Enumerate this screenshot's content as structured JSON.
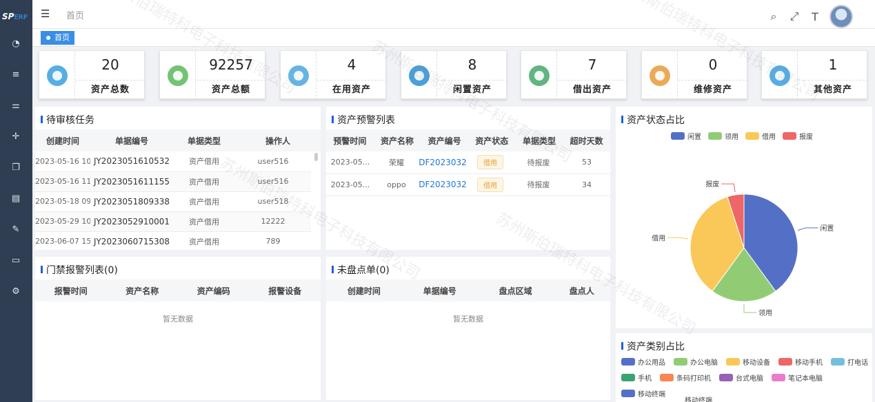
{
  "sidebar": {
    "logo_main": "SP",
    "logo_sub": "ERP",
    "icons": [
      "dashboard-icon",
      "list-icon",
      "sliders-icon",
      "move-icon",
      "box-icon",
      "table-icon",
      "edit-icon",
      "monitor-icon",
      "gear-icon"
    ]
  },
  "topbar": {
    "menu_toggle": "☰",
    "breadcrumb": "首页"
  },
  "tabs": {
    "active": "首页"
  },
  "stats": [
    {
      "value": "20",
      "label": "资产总数",
      "icon": "pie-chart-icon",
      "color": "#3aa0e0"
    },
    {
      "value": "92257",
      "label": "资产总额",
      "icon": "house-icon",
      "color": "#5cb85c"
    },
    {
      "value": "4",
      "label": "在用资产",
      "icon": "gauge-icon",
      "color": "#4aa8df"
    },
    {
      "value": "8",
      "label": "闲置资产",
      "icon": "basket-icon",
      "color": "#2a8fd0"
    },
    {
      "value": "7",
      "label": "借出资产",
      "icon": "tray-icon",
      "color": "#47a86b"
    },
    {
      "value": "0",
      "label": "维修资产",
      "icon": "money-icon",
      "color": "#e69b3c"
    },
    {
      "value": "1",
      "label": "其他资产",
      "icon": "grid-icon",
      "color": "#3aa0e0"
    }
  ],
  "pending": {
    "title": "待审核任务",
    "headers": [
      "创建时间",
      "单据编号",
      "单据类型",
      "操作人"
    ],
    "rows": [
      [
        "2023-05-16 10:...",
        "JY2023051610532",
        "资产借用",
        "user516"
      ],
      [
        "2023-05-16 11:...",
        "JY2023051611155",
        "资产借用",
        "user516"
      ],
      [
        "2023-05-18 09:...",
        "JY2023051809338",
        "资产借用",
        "user518"
      ],
      [
        "2023-05-29 10:...",
        "JY2023052910001",
        "资产借用",
        "12222"
      ],
      [
        "2023-06-07 15:...",
        "JY2023060715308",
        "资产借用",
        "789"
      ]
    ]
  },
  "warning": {
    "title": "资产预警列表",
    "headers": [
      "预警时间",
      "资产名称",
      "资产编号",
      "资产状态",
      "单据类型",
      "超时天数"
    ],
    "rows": [
      [
        "2023-05...",
        "荣耀",
        "DF2023032",
        "借用",
        "待报废",
        "53"
      ],
      [
        "2023-05...",
        "oppo",
        "DF2023032",
        "借用",
        "待报废",
        "34"
      ]
    ]
  },
  "door": {
    "title": "门禁报警列表(0)",
    "headers": [
      "报警时间",
      "资产名称",
      "资产编码",
      "报警设备"
    ],
    "empty": "暂无数据"
  },
  "inventory": {
    "title": "未盘点单(0)",
    "headers": [
      "创建时间",
      "单据编号",
      "盘点区域",
      "盘点人"
    ],
    "empty": "暂无数据"
  },
  "status_pie": {
    "title": "资产状态占比",
    "legend": [
      {
        "name": "闲置",
        "color": "#5470c6"
      },
      {
        "name": "领用",
        "color": "#91cc75"
      },
      {
        "name": "借用",
        "color": "#fac858"
      },
      {
        "name": "报废",
        "color": "#ee6666"
      }
    ]
  },
  "chart_data": {
    "type": "pie",
    "title": "资产状态占比",
    "labels": [
      "闲置",
      "领用",
      "借用",
      "报废"
    ],
    "values": [
      8,
      4,
      7,
      1
    ],
    "colors": [
      "#5470c6",
      "#91cc75",
      "#fac858",
      "#ee6666"
    ]
  },
  "category": {
    "title": "资产类别占比",
    "legend": [
      {
        "name": "办公用品",
        "color": "#5470c6"
      },
      {
        "name": "办公电脑",
        "color": "#91cc75"
      },
      {
        "name": "移动设备",
        "color": "#fac858"
      },
      {
        "name": "移动手机",
        "color": "#ee6666"
      },
      {
        "name": "打电话",
        "color": "#73c0de"
      },
      {
        "name": "手机",
        "color": "#3ba272"
      },
      {
        "name": "条码打印机",
        "color": "#fc8452"
      },
      {
        "name": "台式电脑",
        "color": "#9a60b4"
      },
      {
        "name": "笔记本电脑",
        "color": "#ea7ccc"
      },
      {
        "name": "移动终端",
        "color": "#5470c6"
      }
    ],
    "label": "移动终端"
  },
  "watermark": "苏州斯伯瑞特科电子科技有限公司"
}
